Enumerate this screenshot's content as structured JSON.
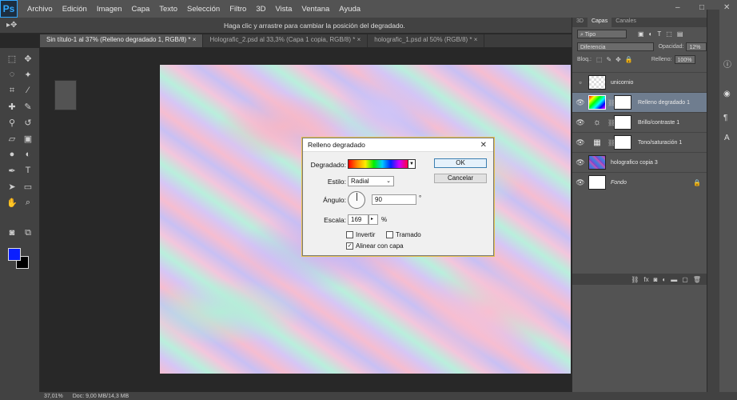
{
  "app": {
    "logo": "Ps"
  },
  "menu": [
    "Archivo",
    "Edición",
    "Imagen",
    "Capa",
    "Texto",
    "Selección",
    "Filtro",
    "3D",
    "Vista",
    "Ventana",
    "Ayuda"
  ],
  "window_controls": [
    "–",
    "□",
    "✕"
  ],
  "options_bar": {
    "hint": "Haga clic y arrastre para cambiar la posición del degradado."
  },
  "tabs": [
    {
      "label": "Sin título-1 al 37% (Relleno degradado 1, RGB/8) *",
      "close": "×"
    },
    {
      "label": "Holografic_2.psd al 33,3% (Capa 1 copia, RGB/8) *",
      "close": "×"
    },
    {
      "label": "holografic_1.psd al 50% (RGB/8) *",
      "close": "×"
    }
  ],
  "colors": {
    "foreground": "#0a1fff",
    "background": "#000000",
    "accent": "#e5c04d"
  },
  "layers_panel": {
    "tabs": [
      "3D",
      "Capas",
      "Canales"
    ],
    "filter": "Tipo",
    "blend_mode": "Diferencia",
    "opacity_label": "Opacidad:",
    "opacity": "12%",
    "lock_label": "Bloq.:",
    "fill_label": "Relleno:",
    "fill": "100%",
    "layers": [
      {
        "name": "unicornio",
        "visible": false,
        "italic": false
      },
      {
        "name": "Relleno degradado 1",
        "visible": true,
        "italic": false
      },
      {
        "name": "Brillo/contraste 1",
        "visible": true,
        "italic": false
      },
      {
        "name": "Tono/saturación 1",
        "visible": true,
        "italic": false
      },
      {
        "name": "holografico copia 3",
        "visible": true,
        "italic": false
      },
      {
        "name": "Fondo",
        "visible": true,
        "italic": true
      }
    ]
  },
  "dialog": {
    "title": "Relleno degradado",
    "gradient_label": "Degradado:",
    "style_label": "Estilo:",
    "style_value": "Radial",
    "angle_label": "Ángulo:",
    "angle_value": "90",
    "angle_unit": "°",
    "scale_label": "Escala:",
    "scale_value": "169",
    "scale_unit": "%",
    "ok_label": "OK",
    "cancel_label": "Cancelar",
    "invert_label": "Invertir",
    "invert_checked": false,
    "dither_label": "Tramado",
    "dither_checked": false,
    "align_label": "Alinear con capa",
    "align_checked": true
  },
  "status": {
    "zoom": "37,01%",
    "doc": "Doc: 9,00 MB/14,3 MB"
  }
}
